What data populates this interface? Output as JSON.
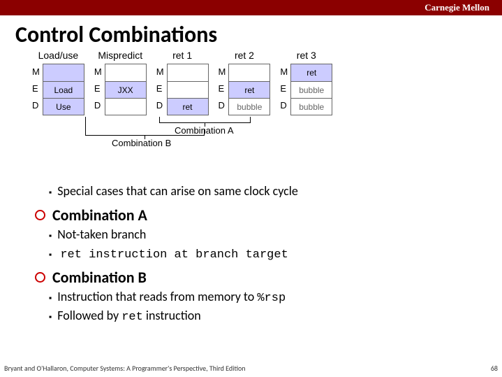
{
  "header": {
    "brand": "Carnegie Mellon"
  },
  "title": "Control Combinations",
  "diagram": {
    "stage_labels": [
      "M",
      "E",
      "D"
    ],
    "cols": [
      {
        "head": "Load/use",
        "cells": [
          {
            "text": "",
            "cls": "bx-blue"
          },
          {
            "text": "Load",
            "cls": "bx-blue"
          },
          {
            "text": "Use",
            "cls": "bx-blue"
          }
        ]
      },
      {
        "head": "Mispredict",
        "cells": [
          {
            "text": "",
            "cls": "bx-white"
          },
          {
            "text": "JXX",
            "cls": "bx-blue mono"
          },
          {
            "text": "",
            "cls": "bx-white"
          }
        ]
      },
      {
        "head": "ret 1",
        "cells": [
          {
            "text": "",
            "cls": "bx-white"
          },
          {
            "text": "",
            "cls": "bx-white"
          },
          {
            "text": "ret",
            "cls": "bx-blue mono"
          }
        ]
      },
      {
        "head": "ret 2",
        "cells": [
          {
            "text": "",
            "cls": "bx-white"
          },
          {
            "text": "ret",
            "cls": "bx-blue mono"
          },
          {
            "text": "bubble",
            "cls": "bx-white"
          }
        ]
      },
      {
        "head": "ret 3",
        "cells": [
          {
            "text": "ret",
            "cls": "bx-blue mono"
          },
          {
            "text": "bubble",
            "cls": "bx-white"
          },
          {
            "text": "bubble",
            "cls": "bx-white"
          }
        ]
      }
    ],
    "combo_a_label": "Combination A",
    "combo_b_label": "Combination B"
  },
  "bullets": {
    "intro": "Special cases that can arise on same clock cycle",
    "combo_a": {
      "title": "Combination A",
      "items": [
        "Not-taken branch",
        " ret instruction at branch target"
      ]
    },
    "combo_b": {
      "title": "Combination B",
      "items": [
        "Instruction that reads from memory to %rsp",
        "Followed by ret instruction"
      ]
    }
  },
  "footer": {
    "left": "Bryant and O'Hallaron, Computer Systems: A Programmer's Perspective, Third Edition",
    "right": "68"
  }
}
